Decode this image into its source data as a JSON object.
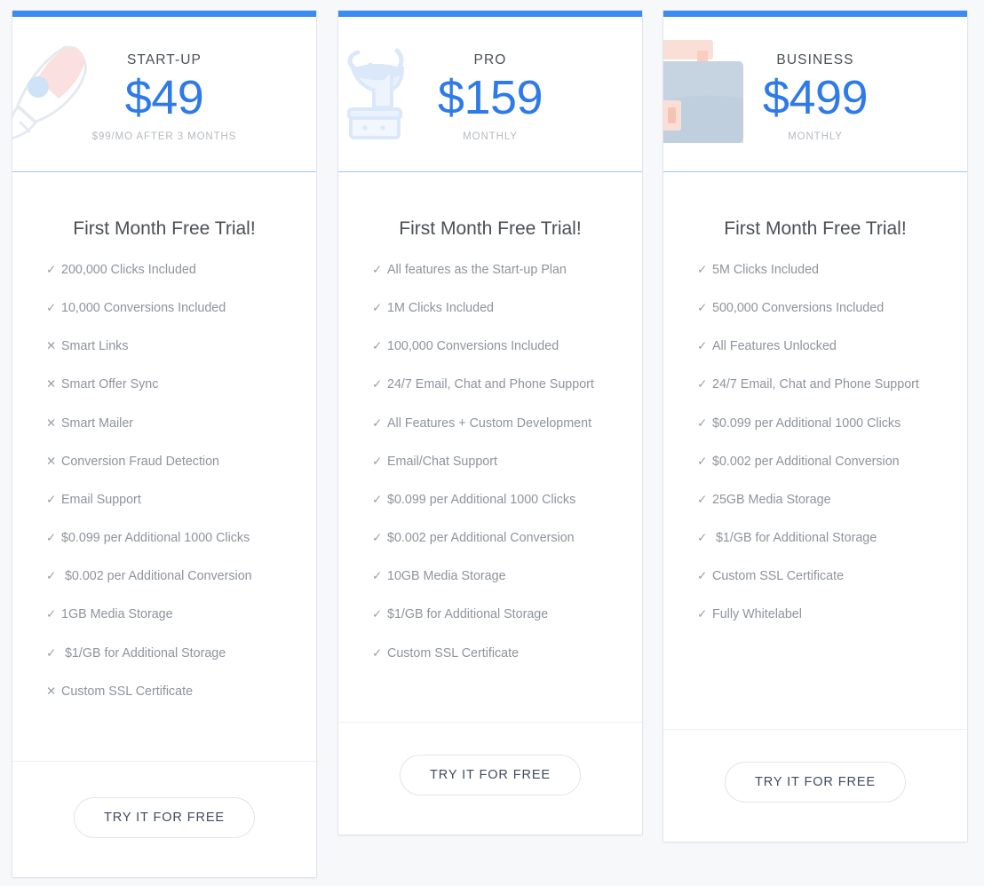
{
  "theme": {
    "accent": "#3b8cf0",
    "price_color": "#2e7ae8",
    "page_background": "#f7f8fa",
    "card_background": "#ffffff",
    "feature_text": "#8e949d",
    "cta_text": "#3f4b5e"
  },
  "plans": [
    {
      "icon": "rocket-icon",
      "name": "START-UP",
      "price": "$49",
      "period": "$99/MO AFTER 3 MONTHS",
      "trial_title": "First Month Free Trial!",
      "cta_label": "TRY IT FOR FREE",
      "features": [
        {
          "mark": "✓",
          "included": true,
          "text": "200,000 Clicks Included"
        },
        {
          "mark": "✓",
          "included": true,
          "text": "10,000 Conversions Included"
        },
        {
          "mark": "✕",
          "included": false,
          "text": "Smart Links"
        },
        {
          "mark": "✕",
          "included": false,
          "text": "Smart Offer Sync"
        },
        {
          "mark": "✕",
          "included": false,
          "text": "Smart Mailer"
        },
        {
          "mark": "✕",
          "included": false,
          "text": "Conversion Fraud Detection"
        },
        {
          "mark": "✓",
          "included": true,
          "text": "Email Support"
        },
        {
          "mark": "✓",
          "included": true,
          "text": "$0.099 per Additional 1000 Clicks"
        },
        {
          "mark": "✓",
          "included": true,
          "text": " $0.002 per Additional Conversion"
        },
        {
          "mark": "✓",
          "included": true,
          "text": "1GB Media Storage"
        },
        {
          "mark": "✓",
          "included": true,
          "text": " $1/GB for Additional Storage"
        },
        {
          "mark": "✕",
          "included": false,
          "text": "Custom SSL Certificate"
        }
      ]
    },
    {
      "icon": "trophy-icon",
      "name": "PRO",
      "price": "$159",
      "period": "MONTHLY",
      "trial_title": "First Month Free Trial!",
      "cta_label": "TRY IT FOR FREE",
      "features": [
        {
          "mark": "✓",
          "included": true,
          "text": "All features as the Start-up Plan"
        },
        {
          "mark": "✓",
          "included": true,
          "text": "1M Clicks Included"
        },
        {
          "mark": "✓",
          "included": true,
          "text": "100,000 Conversions Included"
        },
        {
          "mark": "✓",
          "included": true,
          "text": "24/7 Email, Chat and Phone Support"
        },
        {
          "mark": "✓",
          "included": true,
          "text": "All Features + Custom Development"
        },
        {
          "mark": "✓",
          "included": true,
          "text": "Email/Chat Support"
        },
        {
          "mark": "✓",
          "included": true,
          "text": "$0.099 per Additional 1000 Clicks"
        },
        {
          "mark": "✓",
          "included": true,
          "text": "$0.002 per Additional Conversion"
        },
        {
          "mark": "✓",
          "included": true,
          "text": "10GB Media Storage"
        },
        {
          "mark": "✓",
          "included": true,
          "text": "$1/GB for Additional Storage"
        },
        {
          "mark": "✓",
          "included": true,
          "text": "Custom SSL Certificate"
        }
      ]
    },
    {
      "icon": "briefcase-icon",
      "name": "BUSINESS",
      "price": "$499",
      "period": "MONTHLY",
      "trial_title": "First Month Free Trial!",
      "cta_label": "TRY IT FOR FREE",
      "features": [
        {
          "mark": "✓",
          "included": true,
          "text": "5M Clicks Included"
        },
        {
          "mark": "✓",
          "included": true,
          "text": "500,000 Conversions Included"
        },
        {
          "mark": "✓",
          "included": true,
          "text": "All Features Unlocked"
        },
        {
          "mark": "✓",
          "included": true,
          "text": "24/7 Email, Chat and Phone Support"
        },
        {
          "mark": "✓",
          "included": true,
          "text": "$0.099 per Additional 1000 Clicks"
        },
        {
          "mark": "✓",
          "included": true,
          "text": "$0.002 per Additional Conversion"
        },
        {
          "mark": "✓",
          "included": true,
          "text": "25GB Media Storage"
        },
        {
          "mark": "✓",
          "included": true,
          "text": " $1/GB for Additional Storage"
        },
        {
          "mark": "✓",
          "included": true,
          "text": "Custom SSL Certificate"
        },
        {
          "mark": "✓",
          "included": true,
          "text": "Fully Whitelabel"
        }
      ]
    }
  ]
}
